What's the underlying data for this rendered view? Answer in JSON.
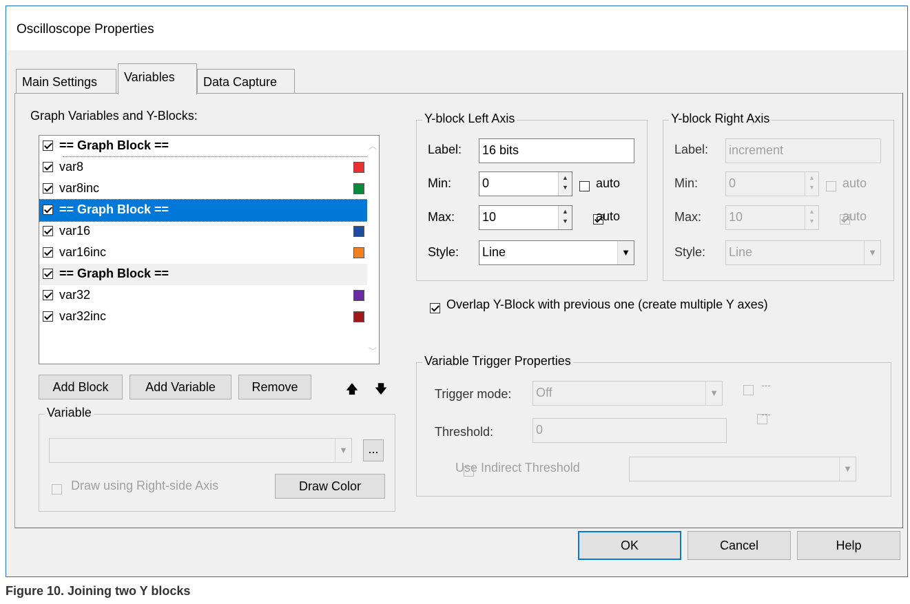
{
  "window": {
    "title": "Oscilloscope Properties"
  },
  "tabs": [
    {
      "label": "Main Settings"
    },
    {
      "label": "Variables"
    },
    {
      "label": "Data Capture"
    }
  ],
  "variables_panel": {
    "list_label": "Graph Variables and Y-Blocks:",
    "rows": [
      {
        "text": "== Graph Block ==",
        "kind": "block",
        "checked": true
      },
      {
        "text": "var8",
        "kind": "var",
        "checked": true,
        "color": "#e8302e"
      },
      {
        "text": "var8inc",
        "kind": "var",
        "checked": true,
        "color": "#0a8a3a"
      },
      {
        "text": "== Graph Block ==",
        "kind": "block",
        "checked": true,
        "selected": true
      },
      {
        "text": "var16",
        "kind": "var",
        "checked": true,
        "color": "#1a4ea0"
      },
      {
        "text": "var16inc",
        "kind": "var",
        "checked": true,
        "color": "#f08020"
      },
      {
        "text": "== Graph Block ==",
        "kind": "block",
        "checked": true
      },
      {
        "text": "var32",
        "kind": "var",
        "checked": true,
        "color": "#6a2aa0"
      },
      {
        "text": "var32inc",
        "kind": "var",
        "checked": true,
        "color": "#a01818"
      }
    ],
    "add_block_label": "Add Block",
    "add_variable_label": "Add Variable",
    "remove_label": "Remove",
    "move_up_icon": "arrow-up-icon",
    "move_down_icon": "arrow-down-icon"
  },
  "variable_group": {
    "legend": "Variable",
    "select_value": "",
    "browse_label": "...",
    "draw_right_axis_label": "Draw using Right-side Axis",
    "draw_color_label": "Draw Color"
  },
  "left_axis": {
    "legend": "Y-block Left Axis",
    "label_caption": "Label:",
    "label_value": "16 bits",
    "min_caption": "Min:",
    "min_value": "0",
    "min_auto": false,
    "max_caption": "Max:",
    "max_value": "10",
    "max_auto": true,
    "auto_label": "auto",
    "style_caption": "Style:",
    "style_value": "Line"
  },
  "right_axis": {
    "legend": "Y-block Right Axis",
    "label_caption": "Label:",
    "label_value": "increment",
    "min_caption": "Min:",
    "min_value": "0",
    "max_caption": "Max:",
    "max_value": "10",
    "auto_label": "auto",
    "style_caption": "Style:",
    "style_value": "Line"
  },
  "overlap_label": "Overlap Y-Block with previous one (create multiple Y axes)",
  "trigger": {
    "legend": "Variable Trigger Properties",
    "mode_caption": "Trigger mode:",
    "mode_value": "Off",
    "check1_label": "---",
    "check2_label": "---",
    "threshold_caption": "Threshold:",
    "threshold_value": "0",
    "indirect_label": "Use Indirect Threshold",
    "indirect_value": ""
  },
  "footer": {
    "ok_label": "OK",
    "cancel_label": "Cancel",
    "help_label": "Help"
  },
  "caption": "Figure 10.  Joining two Y blocks"
}
